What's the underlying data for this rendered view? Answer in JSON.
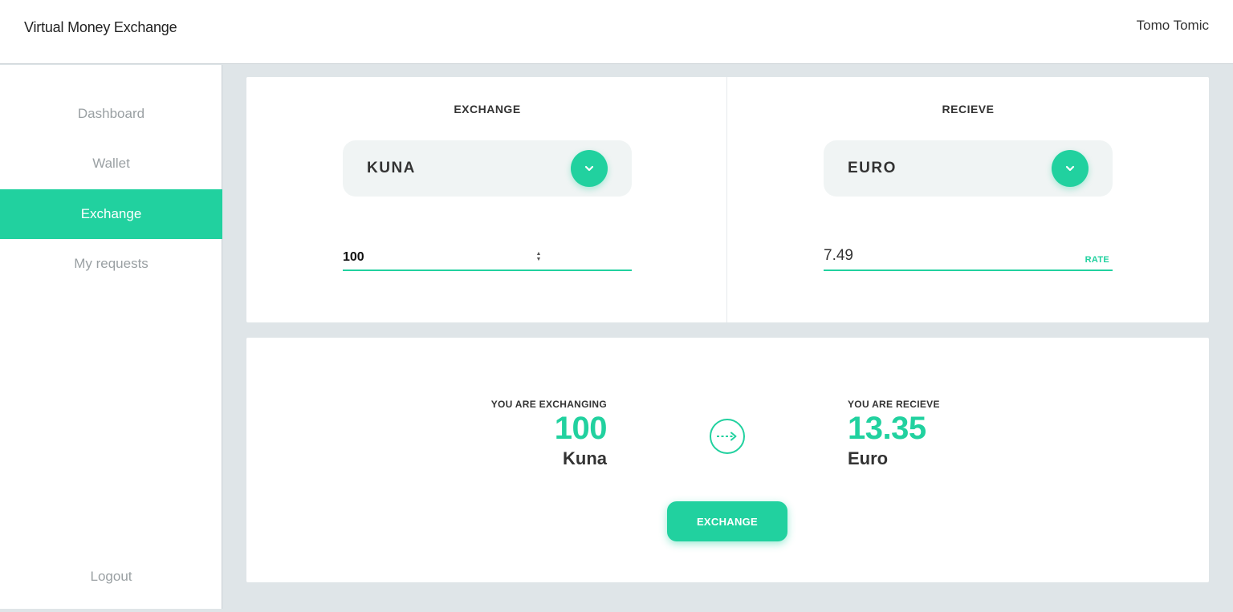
{
  "header": {
    "brand": "Virtual Money Exchange",
    "user_name": "Tomo Tomic"
  },
  "sidebar": {
    "items": [
      {
        "label": "Dashboard",
        "active": false
      },
      {
        "label": "Wallet",
        "active": false
      },
      {
        "label": "Exchange",
        "active": true
      },
      {
        "label": "My requests",
        "active": false
      }
    ],
    "logout_label": "Logout"
  },
  "exchange": {
    "title": "EXCHANGE",
    "currency": "KUNA",
    "amount": "100",
    "dropdown_icon": "chevron-down-icon"
  },
  "receive": {
    "title": "RECIEVE",
    "currency": "EURO",
    "rate_value": "7.49",
    "rate_label": "RATE",
    "dropdown_icon": "chevron-down-icon"
  },
  "summary": {
    "exchanging_caption": "YOU ARE EXCHANGING",
    "exchanging_amount": "100",
    "exchanging_currency": "Kuna",
    "receive_caption": "YOU ARE RECIEVE",
    "receive_amount": "13.35",
    "receive_currency": "Euro",
    "arrow_icon": "dashed-arrow-right-icon",
    "button_label": "EXCHANGE"
  },
  "colors": {
    "accent": "#21d19f",
    "background": "#dfe5e8",
    "select_bg": "#f0f4f4"
  }
}
